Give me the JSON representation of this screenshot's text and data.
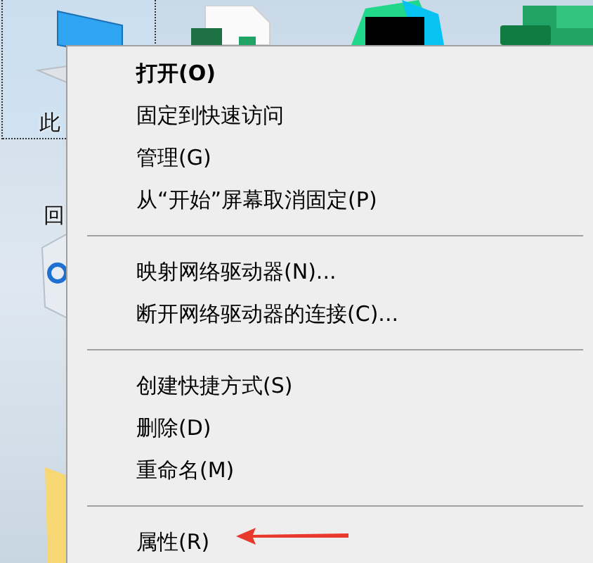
{
  "desktop_icons": [
    {
      "label": "此"
    },
    {
      "label": "回"
    }
  ],
  "context_menu": {
    "items": [
      {
        "kind": "item",
        "label": "打开(O)",
        "default": true
      },
      {
        "kind": "item",
        "label": "固定到快速访问",
        "default": false
      },
      {
        "kind": "item",
        "label": "管理(G)",
        "default": false
      },
      {
        "kind": "item",
        "label": "从“开始”屏幕取消固定(P)",
        "default": false
      },
      {
        "kind": "separator"
      },
      {
        "kind": "item",
        "label": "映射网络驱动器(N)...",
        "default": false
      },
      {
        "kind": "item",
        "label": "断开网络驱动器的连接(C)...",
        "default": false
      },
      {
        "kind": "separator"
      },
      {
        "kind": "item",
        "label": "创建快捷方式(S)",
        "default": false
      },
      {
        "kind": "item",
        "label": "删除(D)",
        "default": false
      },
      {
        "kind": "item",
        "label": "重命名(M)",
        "default": false
      },
      {
        "kind": "separator"
      },
      {
        "kind": "item",
        "label": "属性(R)",
        "default": false
      }
    ]
  }
}
